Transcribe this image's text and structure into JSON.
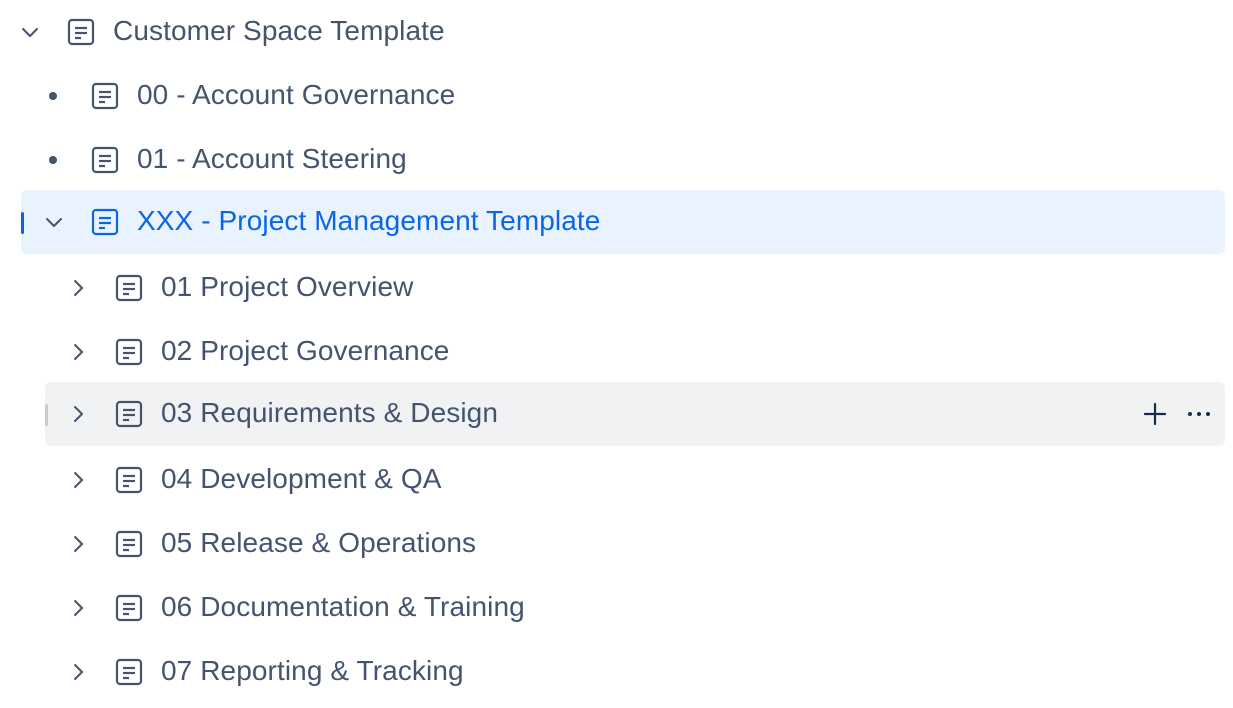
{
  "tree": {
    "root": {
      "label": "Customer Space Template",
      "icon": "page-icon",
      "expander": "chevron-down-icon"
    },
    "children": [
      {
        "label": "00 - Account Governance",
        "icon": "page-icon",
        "marker": "bullet"
      },
      {
        "label": "01 - Account Steering",
        "icon": "page-icon",
        "marker": "bullet"
      },
      {
        "label": "XXX - Project Management Template",
        "icon": "page-icon",
        "expander": "chevron-down-icon",
        "state": "selected"
      }
    ],
    "subchildren": [
      {
        "label": "01 Project Overview",
        "icon": "page-icon",
        "expander": "chevron-right-icon"
      },
      {
        "label": "02 Project Governance",
        "icon": "page-icon",
        "expander": "chevron-right-icon"
      },
      {
        "label": "03 Requirements & Design",
        "icon": "page-icon",
        "expander": "chevron-right-icon",
        "state": "hovered"
      },
      {
        "label": "04 Development & QA",
        "icon": "page-icon",
        "expander": "chevron-right-icon"
      },
      {
        "label": "05 Release & Operations",
        "icon": "page-icon",
        "expander": "chevron-right-icon"
      },
      {
        "label": "06 Documentation & Training",
        "icon": "page-icon",
        "expander": "chevron-right-icon"
      },
      {
        "label": "07 Reporting & Tracking",
        "icon": "page-icon",
        "expander": "chevron-right-icon"
      }
    ],
    "hover_actions": [
      "plus-icon",
      "more-icon"
    ]
  },
  "colors": {
    "text": "#44546f",
    "selected_text": "#0c66e4",
    "selected_bg": "#e9f2ff",
    "hover_bg": "#f1f2f4",
    "selected_indicator": "#0c66e4",
    "hover_indicator": "#c7cbd1"
  }
}
